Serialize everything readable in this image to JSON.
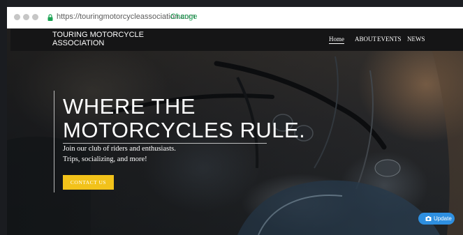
{
  "browser": {
    "url": "https://touringmotorcycleassociation.com",
    "change_label": "Change"
  },
  "site": {
    "brand": "TOURING MOTORCYCLE ASSOCIATION",
    "nav": {
      "home": "Home",
      "about": "ABOUT",
      "events": "EVENTS",
      "news": "NEWS"
    },
    "hero": {
      "headline_line1": "WHERE THE",
      "headline_line2": "MOTORCYCLES RULE.",
      "sub_line1": "Join our club of riders and enthusiasts.",
      "sub_line2": "Trips, socializing, and more!",
      "cta_label": "CONTACT US"
    },
    "update_label": "Update"
  },
  "colors": {
    "cta": "#f2c21a",
    "update": "#2e8fe0",
    "change_link": "#1aa353",
    "navbar": "#151516"
  }
}
